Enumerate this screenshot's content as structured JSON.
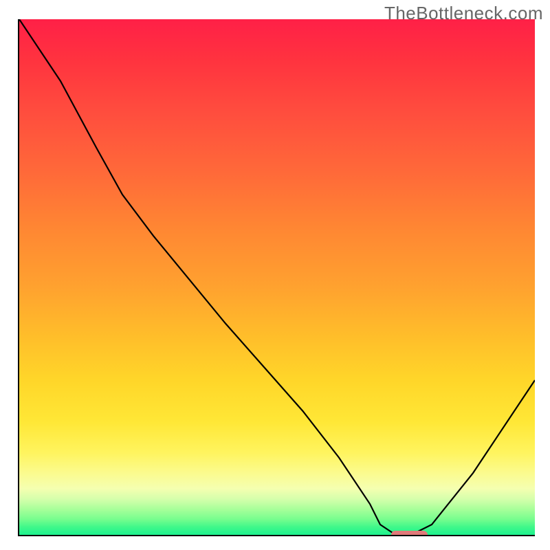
{
  "watermark": "TheBottleneck.com",
  "chart_data": {
    "type": "line",
    "title": "",
    "xlabel": "",
    "ylabel": "",
    "xlim": [
      0,
      100
    ],
    "ylim": [
      0,
      100
    ],
    "grid": false,
    "legend": false,
    "background": "rainbow-vertical-gradient",
    "series": [
      {
        "name": "bottleneck-curve",
        "x": [
          0,
          8,
          15,
          20,
          26,
          40,
          55,
          62,
          68,
          70,
          73,
          76,
          80,
          88,
          96,
          100
        ],
        "y": [
          100,
          88,
          75,
          66,
          58,
          41,
          24,
          15,
          6,
          2,
          0,
          0,
          2,
          12,
          24,
          30
        ]
      }
    ],
    "marker": {
      "name": "optimal-range",
      "x_start": 72,
      "x_end": 79,
      "y": 0,
      "color": "#e17a7a"
    }
  }
}
